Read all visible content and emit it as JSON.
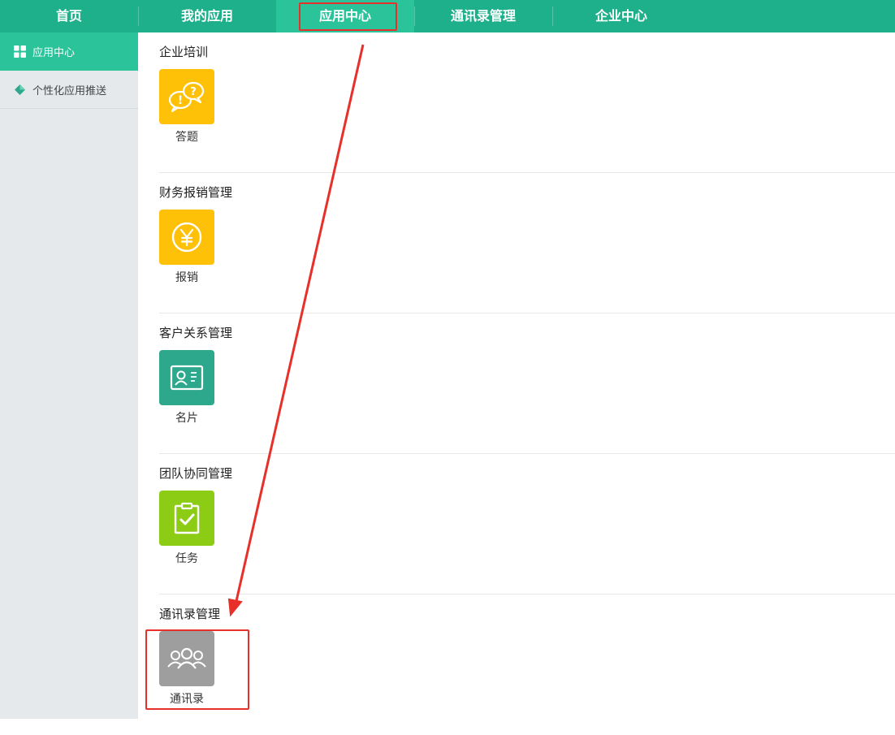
{
  "topnav": {
    "items": [
      {
        "label": "首页"
      },
      {
        "label": "我的应用"
      },
      {
        "label": "应用中心"
      },
      {
        "label": "通讯录管理"
      },
      {
        "label": "企业中心"
      }
    ],
    "active_index": 2
  },
  "sidebar": {
    "items": [
      {
        "label": "应用中心",
        "icon": "grid-icon"
      },
      {
        "label": "个性化应用推送",
        "icon": "diamond-icon"
      }
    ]
  },
  "sections": [
    {
      "title": "企业培训",
      "app": {
        "label": "答题",
        "icon": "speech-bubbles-icon",
        "color": "#ffc107"
      }
    },
    {
      "title": "财务报销管理",
      "app": {
        "label": "报销",
        "icon": "yen-icon",
        "color": "#ffc107"
      }
    },
    {
      "title": "客户关系管理",
      "app": {
        "label": "名片",
        "icon": "business-card-icon",
        "color": "#2ea88c"
      }
    },
    {
      "title": "团队协同管理",
      "app": {
        "label": "任务",
        "icon": "clipboard-check-icon",
        "color": "#8ccc14"
      }
    },
    {
      "title": "通讯录管理",
      "app": {
        "label": "通讯录",
        "icon": "people-icon",
        "color": "#9e9e9e"
      }
    }
  ],
  "colors": {
    "nav_bg": "#1db08a",
    "nav_active": "#2bc39a",
    "highlight": "#e8302a"
  }
}
